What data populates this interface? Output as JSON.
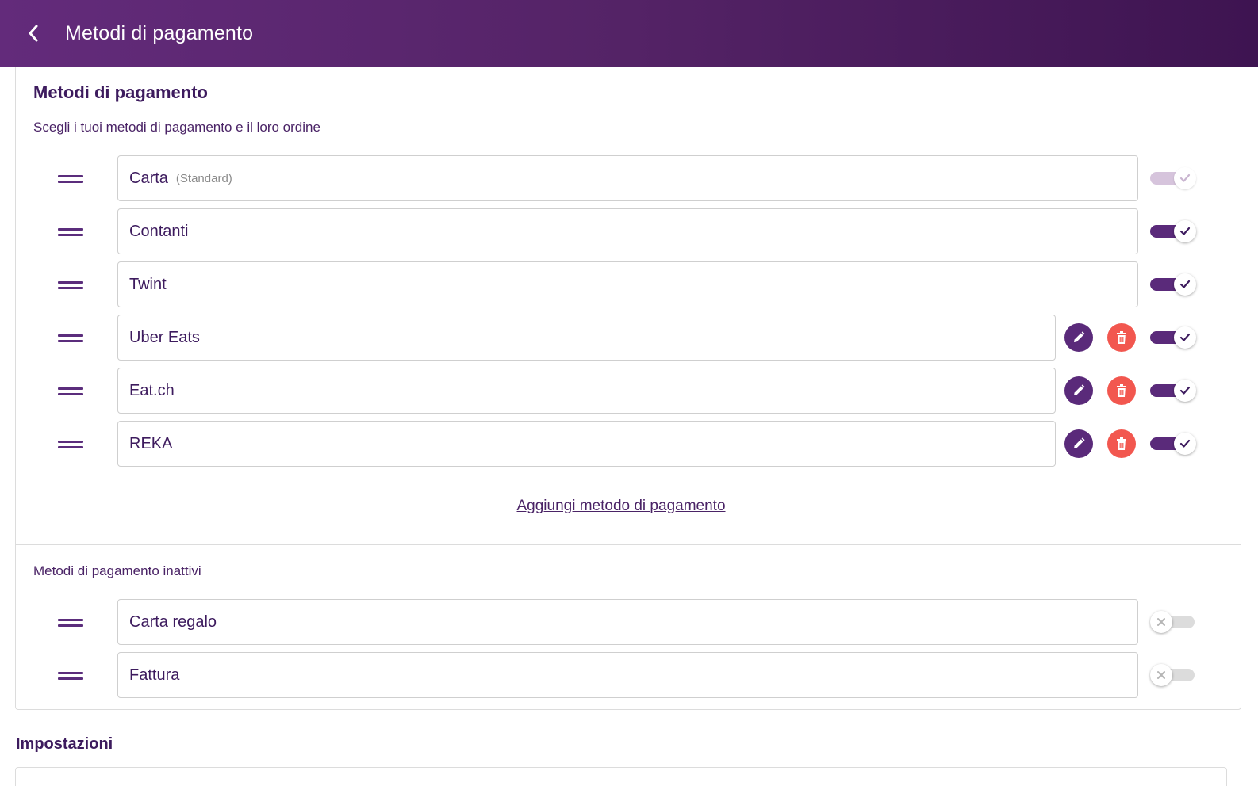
{
  "header": {
    "title": "Metodi di pagamento",
    "back_icon": "chevron-left-icon"
  },
  "active_section": {
    "title": "Metodi di pagamento",
    "subtitle": "Scegli i tuoi metodi di pagamento e il loro ordine",
    "methods": [
      {
        "name": "Carta",
        "tag": "(Standard)",
        "enabled": true,
        "toggle_locked": true,
        "editable": false
      },
      {
        "name": "Contanti",
        "tag": "",
        "enabled": true,
        "toggle_locked": false,
        "editable": false
      },
      {
        "name": "Twint",
        "tag": "",
        "enabled": true,
        "toggle_locked": false,
        "editable": false
      },
      {
        "name": "Uber Eats",
        "tag": "",
        "enabled": true,
        "toggle_locked": false,
        "editable": true
      },
      {
        "name": "Eat.ch",
        "tag": "",
        "enabled": true,
        "toggle_locked": false,
        "editable": true
      },
      {
        "name": "REKA",
        "tag": "",
        "enabled": true,
        "toggle_locked": false,
        "editable": true
      }
    ],
    "add_link": "Aggiungi metodo di pagamento"
  },
  "inactive_section": {
    "title": "Metodi di pagamento inattivi",
    "methods": [
      {
        "name": "Carta regalo",
        "enabled": false
      },
      {
        "name": "Fattura",
        "enabled": false
      }
    ]
  },
  "settings": {
    "title": "Impostazioni"
  },
  "colors": {
    "accent": "#5a2a7a",
    "delete": "#f2574f",
    "header_start": "#632b7b",
    "header_end": "#3e1451"
  }
}
